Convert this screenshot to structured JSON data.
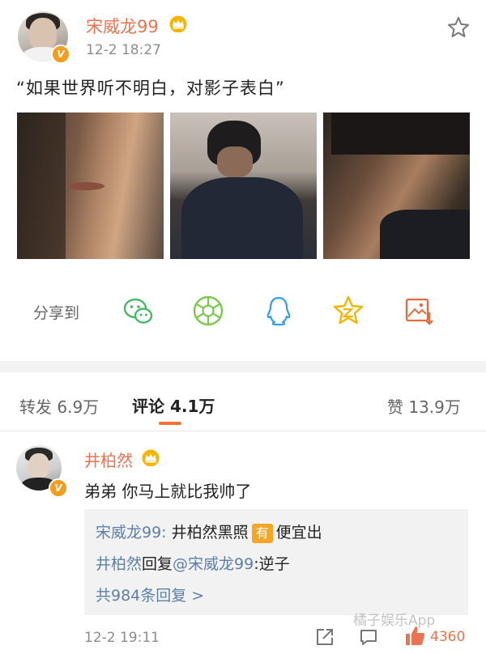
{
  "post": {
    "author": "宋威龙99",
    "time": "12-2 18:27",
    "text": "“如果世界听不明白，对影子表白”",
    "verified_badge": "V",
    "photos": [
      "photo-side-profile",
      "photo-hand-on-face",
      "photo-looking-down"
    ]
  },
  "share": {
    "label": "分享到",
    "targets": [
      "wechat-icon",
      "moments-icon",
      "qq-icon",
      "qzone-icon",
      "save-image-icon"
    ]
  },
  "tabs": {
    "repost": "转发 6.9万",
    "comments": "评论 4.1万",
    "likes": "赞 13.9万",
    "accent": "#f77234"
  },
  "comment": {
    "author": "井柏然",
    "text": "弟弟 你马上就比我帅了",
    "reply1_author": "宋威龙99:",
    "reply1_text_a": "井柏然黑照",
    "reply1_tag": "有",
    "reply1_text_b": "便宜出",
    "reply2_author": "井柏然",
    "reply2_mid": "回复",
    "reply2_mention": "@宋威龙99",
    "reply2_text": ":逆子",
    "more_replies": "共984条回复 >",
    "time": "12-2 19:11",
    "like_count": "4360"
  },
  "watermark": "橘子娱乐App",
  "colors": {
    "username": "#eb7350",
    "link": "#5d7fa8",
    "verified": "#f49c1b"
  }
}
